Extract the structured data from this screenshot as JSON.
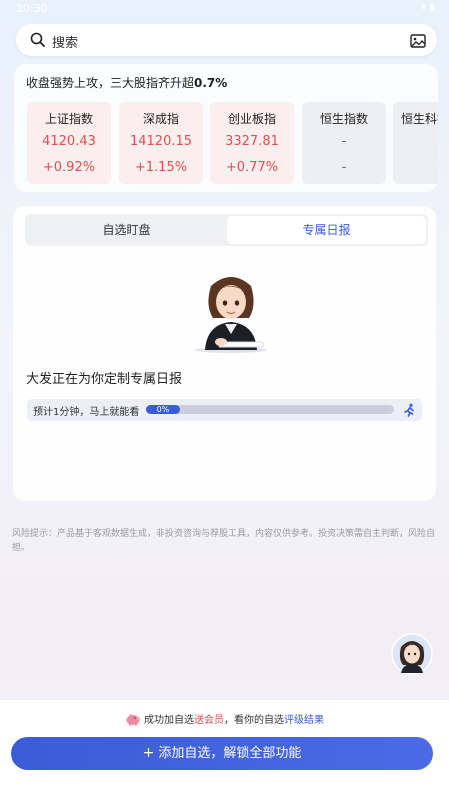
{
  "status_bar": {
    "time": "10:30",
    "icons": "▾ ▮"
  },
  "search": {
    "placeholder": "搜索"
  },
  "market": {
    "headline_prefix": "收盘强势上攻，三大股指齐升超",
    "headline_value": "0.7%",
    "indices": [
      {
        "name": "上证指数",
        "value": "4120.43",
        "change": "+0.92%",
        "trend": "up"
      },
      {
        "name": "深成指",
        "value": "14120.15",
        "change": "+1.15%",
        "trend": "up"
      },
      {
        "name": "创业板指",
        "value": "3327.81",
        "change": "+0.77%",
        "trend": "up"
      },
      {
        "name": "恒生指数",
        "value": "-",
        "change": "-",
        "trend": "flat"
      },
      {
        "name": "恒生科技",
        "value": "-",
        "change": "-",
        "trend": "flat"
      }
    ]
  },
  "panel": {
    "tabs": [
      "自选盯盘",
      "专属日报"
    ],
    "active_tab": "专属日报",
    "building_message": "大发正在为你定制专属日报",
    "eta": "预计1分钟，马上就能看",
    "progress_label": "0%",
    "progress": 0
  },
  "risk_notice": "风险提示：产品基于客观数据生成，非投资咨询与荐股工具，内容仅供参考。投资决策需自主判断，风险自担。",
  "promo": {
    "part1": "成功加自选",
    "link1": "送会员",
    "part2": "，看你的自选",
    "link2": "评级结果"
  },
  "cta": {
    "plus": "+",
    "label": "添加自选，解锁全部功能"
  },
  "colors": {
    "accent": "#3c5cd7",
    "up": "#e05050",
    "up_bg": "#fbeeee",
    "flat_bg": "#eeeff2"
  },
  "icons": {
    "search": "search-icon",
    "image": "image-icon",
    "runner": "runner-icon",
    "pig": "piggy-icon"
  }
}
